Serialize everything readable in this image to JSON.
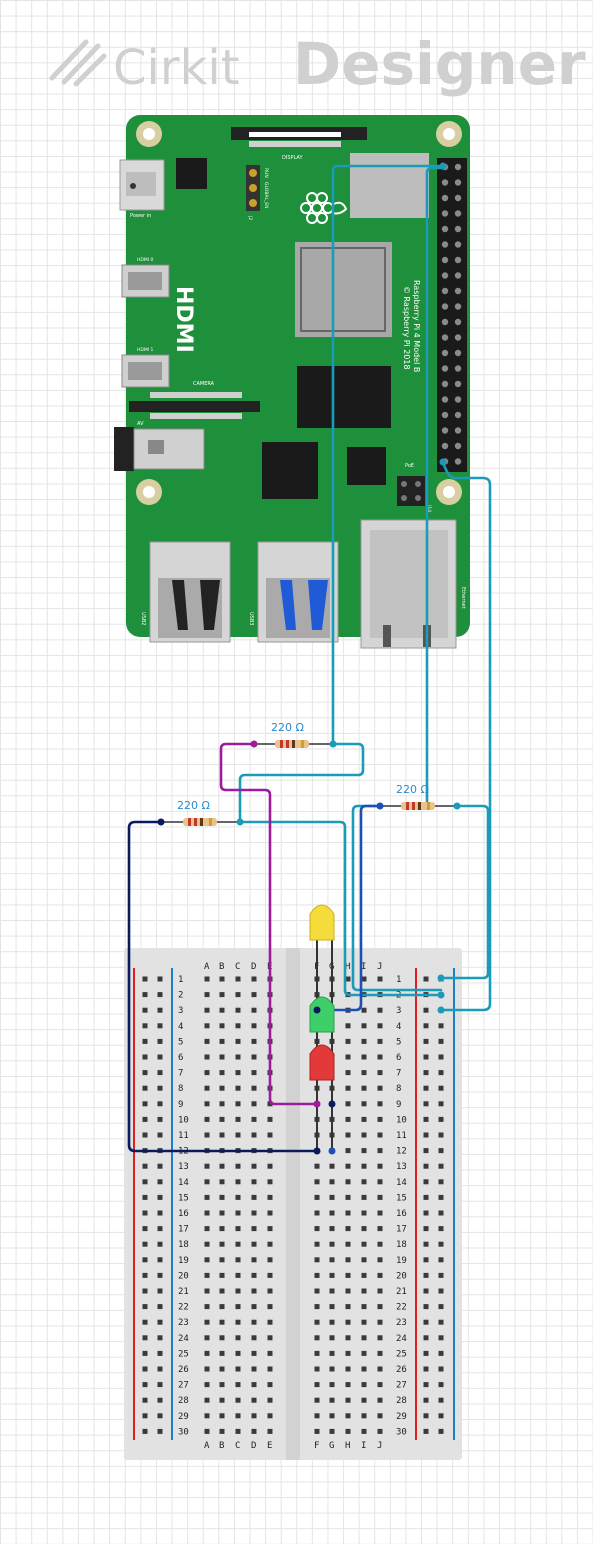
{
  "logo": {
    "word1": "Cirkit",
    "word2": "Designer"
  },
  "board": {
    "display_label": "DISPLAY",
    "power_label": "Power in",
    "hdmi0_label": "HDMI 0",
    "hdmi1_label": "HDMI 1",
    "hdmi_big_label": "HDMI",
    "camera_label": "CAMERA",
    "av_label": "AV",
    "model_line1": "Raspberry Pi 4 Model B",
    "model_line2": "© Raspberry Pi 2018",
    "poe_label": "PoE",
    "usb2_label": "USB2",
    "usb3_label": "USB3",
    "ethernet_label": "Ethernet",
    "run_label": "RUN",
    "global_en_label": "GLOBAL_EN",
    "j2_label": "J2",
    "j14_label": "J14",
    "brand_color": "#1e8f3a"
  },
  "resistors": [
    {
      "id": "r1",
      "label": "220 Ω"
    },
    {
      "id": "r2",
      "label": "220 Ω"
    },
    {
      "id": "r3",
      "label": "220 Ω"
    }
  ],
  "leds": [
    {
      "id": "led-yellow",
      "color": "#f5dc3a"
    },
    {
      "id": "led-green",
      "color": "#3ecf6a"
    },
    {
      "id": "led-red",
      "color": "#e23a3a"
    }
  ],
  "breadboard": {
    "cols_left": [
      "A",
      "B",
      "C",
      "D",
      "E"
    ],
    "cols_right": [
      "F",
      "G",
      "H",
      "I",
      "J"
    ],
    "rows": 30
  },
  "wire_colors": {
    "teal": "#1a9bb8",
    "purple": "#9b1d9b",
    "navy": "#0b1a5e",
    "blue": "#1e4fb5"
  }
}
